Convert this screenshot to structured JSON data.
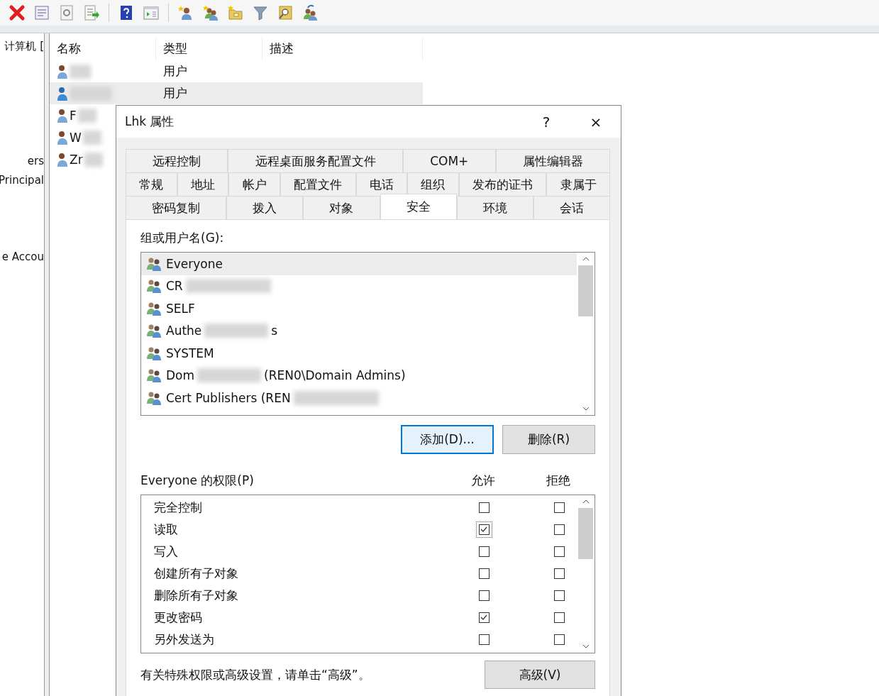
{
  "tree": {
    "items": [
      {
        "label": "计算机 ["
      },
      {
        "label": "ers"
      },
      {
        "label": "Principal"
      },
      {
        "label": "e Accou"
      }
    ]
  },
  "list": {
    "columns": [
      "名称",
      "类型",
      "描述"
    ],
    "rows": [
      {
        "type": "用户",
        "selected": false
      },
      {
        "type": "用户",
        "selected": true
      },
      {
        "name": "F",
        "selected": false
      },
      {
        "name": "W",
        "selected": false
      },
      {
        "name": "Zr",
        "selected": false
      }
    ]
  },
  "dialog": {
    "title": "Lhk 属性",
    "help": "?",
    "close": "×",
    "tab_rows": [
      [
        {
          "label": "远程控制",
          "selected": false
        },
        {
          "label": "远程桌面服务配置文件",
          "selected": false
        },
        {
          "label": "COM+",
          "selected": false
        },
        {
          "label": "属性编辑器",
          "selected": false
        }
      ],
      [
        {
          "label": "常规",
          "selected": false
        },
        {
          "label": "地址",
          "selected": false
        },
        {
          "label": "帐户",
          "selected": false
        },
        {
          "label": "配置文件",
          "selected": false
        },
        {
          "label": "电话",
          "selected": false
        },
        {
          "label": "组织",
          "selected": false
        },
        {
          "label": "发布的证书",
          "selected": false
        },
        {
          "label": "隶属于",
          "selected": false
        }
      ],
      [
        {
          "label": "密码复制",
          "selected": false
        },
        {
          "label": "拨入",
          "selected": false
        },
        {
          "label": "对象",
          "selected": false
        },
        {
          "label": "安全",
          "selected": true
        },
        {
          "label": "环境",
          "selected": false
        },
        {
          "label": "会话",
          "selected": false
        }
      ]
    ],
    "groups_label": "组或用户名(G):",
    "groups": [
      {
        "name": "Everyone",
        "redacted": false,
        "selected": true
      },
      {
        "name": "CR",
        "redacted": true,
        "selected": false
      },
      {
        "name": "SELF",
        "redacted": false,
        "selected": false
      },
      {
        "name": "Authe",
        "redacted": true,
        "tail": "s",
        "selected": false
      },
      {
        "name": "SYSTEM",
        "redacted": false,
        "selected": false
      },
      {
        "name": "Dom",
        "redacted": true,
        "tail": "(REN0\\Domain Admins)",
        "selected": false
      },
      {
        "name": "Cert Publishers (REN",
        "redacted": true,
        "selected": false
      }
    ],
    "add_button": {
      "label": "添加(D)...",
      "focused": true
    },
    "remove_button": {
      "label": "删除(R)"
    },
    "permissions_label": "Everyone 的权限(P)",
    "allow_header": "允许",
    "deny_header": "拒绝",
    "permissions": [
      {
        "name": "完全控制",
        "allow": false,
        "deny": false,
        "focused": false
      },
      {
        "name": "读取",
        "allow": true,
        "deny": false,
        "focused": true
      },
      {
        "name": "写入",
        "allow": false,
        "deny": false,
        "focused": false
      },
      {
        "name": "创建所有子对象",
        "allow": false,
        "deny": false,
        "focused": false
      },
      {
        "name": "删除所有子对象",
        "allow": false,
        "deny": false,
        "focused": false
      },
      {
        "name": "更改密码",
        "allow": true,
        "deny": false,
        "focused": false
      },
      {
        "name": "另外发送为",
        "allow": false,
        "deny": false,
        "focused": false
      }
    ],
    "advanced_hint": "有关特殊权限或高级设置，请单击“高级”。",
    "advanced_button": "高级(V)"
  }
}
